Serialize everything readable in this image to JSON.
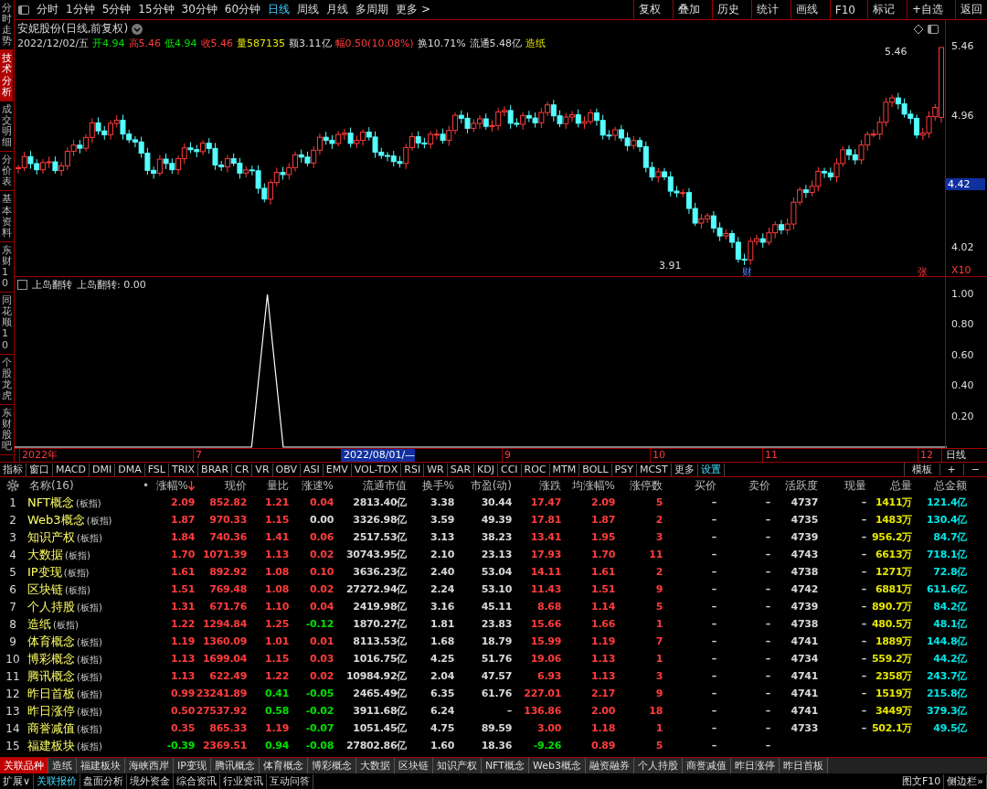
{
  "side_tabs": [
    {
      "label": "分时走势",
      "selected": false
    },
    {
      "label": "技术分析",
      "selected": true
    },
    {
      "label": "成交明细",
      "selected": false
    },
    {
      "label": "分价表",
      "selected": false
    },
    {
      "label": "基本资料",
      "selected": false
    },
    {
      "label": "东财10",
      "selected": false
    },
    {
      "label": "同花顺10",
      "selected": false
    },
    {
      "label": "个股龙虎",
      "selected": false
    },
    {
      "label": "东财股吧",
      "selected": false
    }
  ],
  "periods": [
    {
      "label": "分时",
      "selected": false
    },
    {
      "label": "1分钟",
      "selected": false
    },
    {
      "label": "5分钟",
      "selected": false
    },
    {
      "label": "15分钟",
      "selected": false
    },
    {
      "label": "30分钟",
      "selected": false
    },
    {
      "label": "60分钟",
      "selected": false
    },
    {
      "label": "日线",
      "selected": true
    },
    {
      "label": "周线",
      "selected": false
    },
    {
      "label": "月线",
      "selected": false
    },
    {
      "label": "多周期",
      "selected": false
    },
    {
      "label": "更多 >",
      "selected": false
    }
  ],
  "toolbar_buttons": [
    "复权",
    "叠加",
    "历史",
    "统计",
    "画线",
    "F10",
    "标记",
    "+自选",
    "返回"
  ],
  "stock_title": "安妮股份(日线,前复权)",
  "quote_items": [
    {
      "text": "2022/12/02/五",
      "kind": "flat"
    },
    {
      "text": "开4.94",
      "kind": "down"
    },
    {
      "text": "高5.46",
      "kind": "up"
    },
    {
      "text": "低4.94",
      "kind": "down"
    },
    {
      "text": "收5.46",
      "kind": "up"
    },
    {
      "text": "量587135",
      "kind": "vol"
    },
    {
      "text": "额3.11亿",
      "kind": "flat"
    },
    {
      "text": "幅0.50(10.08%)",
      "kind": "up"
    },
    {
      "text": "换10.71%",
      "kind": "flat"
    },
    {
      "text": "流通5.48亿",
      "kind": "flat"
    },
    {
      "text": "造纸",
      "kind": "vol"
    }
  ],
  "price_axis": [
    {
      "text": "5.46",
      "highlighted": false
    },
    {
      "text": "4.96",
      "highlighted": false
    },
    {
      "text": "4.42",
      "highlighted": true
    },
    {
      "text": "4.02",
      "highlighted": false
    },
    {
      "text": "X10",
      "highlighted": false
    }
  ],
  "price_marks": {
    "high": "5.46",
    "low": "3.91",
    "news_tag": "财",
    "limit_tag": "张"
  },
  "indicator": {
    "reading": ": 0.00",
    "chart_data": {
      "type": "line",
      "title": "上岛翻转",
      "categories": [
        null,
        null,
        null,
        null,
        null,
        null,
        null,
        null,
        null,
        null,
        null,
        null,
        null,
        null,
        null,
        null,
        null,
        null,
        null,
        null,
        null,
        null,
        null,
        null,
        null,
        null,
        null,
        null,
        null,
        null,
        null,
        null,
        null,
        null,
        null,
        null,
        null,
        null,
        null,
        null,
        null,
        null,
        null,
        null,
        null,
        null,
        null,
        null,
        null,
        null,
        null,
        null,
        null,
        null,
        null,
        null,
        null,
        null,
        null,
        null
      ],
      "series": [
        {
          "name": "上岛翻转",
          "color": "#ffffff",
          "values": [
            0,
            0,
            0,
            0,
            0,
            0,
            0,
            0,
            0,
            0,
            0,
            0,
            0,
            0,
            0,
            0,
            1,
            0,
            0,
            0,
            0,
            0,
            0,
            0,
            0,
            0,
            0,
            0,
            0,
            0,
            0,
            0,
            0,
            0,
            0,
            0,
            0,
            0,
            0,
            0,
            0,
            0,
            0,
            0,
            0,
            0,
            0,
            0,
            0,
            0,
            0,
            0,
            0,
            0,
            0,
            0,
            0,
            0,
            0,
            0
          ]
        }
      ],
      "ylim": [
        0,
        1
      ],
      "yticks": [
        {
          "value": 1,
          "label": "1.00"
        },
        {
          "value": 0.8,
          "label": "0.80"
        },
        {
          "value": 0.6,
          "label": "0.60"
        },
        {
          "value": 0.4,
          "label": "0.40"
        },
        {
          "value": 0.2,
          "label": "0.20"
        }
      ]
    }
  },
  "date_axis": [
    {
      "text": "2022年",
      "highlighted": false
    },
    {
      "text": "7",
      "highlighted": false
    },
    {
      "text": "2022/08/01/—",
      "highlighted": true
    },
    {
      "text": "9",
      "highlighted": false
    },
    {
      "text": "10",
      "highlighted": false
    },
    {
      "text": "11",
      "highlighted": false
    },
    {
      "text": "12",
      "highlighted": false
    }
  ],
  "date_axis_period": "日线",
  "indicator_tabs": [
    {
      "label": "指标",
      "kind": "tab"
    },
    {
      "label": "窗口",
      "kind": "tab"
    },
    {
      "label": "MACD",
      "kind": "tab"
    },
    {
      "label": "DMI",
      "kind": "tab"
    },
    {
      "label": "DMA",
      "kind": "tab"
    },
    {
      "label": "FSL",
      "kind": "tab"
    },
    {
      "label": "TRIX",
      "kind": "tab"
    },
    {
      "label": "BRAR",
      "kind": "tab"
    },
    {
      "label": "CR",
      "kind": "tab"
    },
    {
      "label": "VR",
      "kind": "tab"
    },
    {
      "label": "OBV",
      "kind": "tab"
    },
    {
      "label": "ASI",
      "kind": "tab"
    },
    {
      "label": "EMV",
      "kind": "tab"
    },
    {
      "label": "VOL-TDX",
      "kind": "tab"
    },
    {
      "label": "RSI",
      "kind": "tab"
    },
    {
      "label": "WR",
      "kind": "tab"
    },
    {
      "label": "SAR",
      "kind": "tab"
    },
    {
      "label": "KDJ",
      "kind": "tab"
    },
    {
      "label": "CCI",
      "kind": "tab"
    },
    {
      "label": "ROC",
      "kind": "tab"
    },
    {
      "label": "MTM",
      "kind": "tab"
    },
    {
      "label": "BOLL",
      "kind": "tab"
    },
    {
      "label": "PSY",
      "kind": "tab"
    },
    {
      "label": "MCST",
      "kind": "tab"
    },
    {
      "label": "更多",
      "kind": "tab"
    },
    {
      "label": "设置",
      "kind": "action"
    }
  ],
  "indicator_tools": [
    "模板",
    "+",
    "−"
  ],
  "table": {
    "name_header": "名称(16)",
    "dot_header": "•",
    "columns": [
      {
        "label": "涨幅%",
        "sorted": true
      },
      {
        "label": "现价",
        "sorted": false
      },
      {
        "label": "量比",
        "sorted": false
      },
      {
        "label": "涨速%",
        "sorted": false
      },
      {
        "label": "流通市值",
        "sorted": false
      },
      {
        "label": "换手%",
        "sorted": false
      },
      {
        "label": "市盈(动)",
        "sorted": false
      },
      {
        "label": "涨跌",
        "sorted": false
      },
      {
        "label": "均涨幅%",
        "sorted": false
      },
      {
        "label": "涨停数",
        "sorted": false
      },
      {
        "label": "买价",
        "sorted": false
      },
      {
        "label": "卖价",
        "sorted": false
      },
      {
        "label": "活跃度",
        "sorted": false
      },
      {
        "label": "现量",
        "sorted": false
      },
      {
        "label": "总量",
        "sorted": false
      },
      {
        "label": "总金额",
        "sorted": false
      }
    ],
    "rows": [
      {
        "index": "1",
        "name": "NFT概念",
        "tag": "(板指)",
        "cells": [
          {
            "text": "2.09",
            "kind": "up"
          },
          {
            "text": "852.82",
            "kind": "up"
          },
          {
            "text": "1.21",
            "kind": "up"
          },
          {
            "text": "0.04",
            "kind": "up"
          },
          {
            "text": "2813.40亿",
            "kind": "flat"
          },
          {
            "text": "3.38",
            "kind": "flat"
          },
          {
            "text": "30.44",
            "kind": "flat"
          },
          {
            "text": "17.47",
            "kind": "up"
          },
          {
            "text": "2.09",
            "kind": "up"
          },
          {
            "text": "5",
            "kind": "up"
          },
          {
            "text": "–",
            "kind": "flat"
          },
          {
            "text": "–",
            "kind": "flat"
          },
          {
            "text": "4737",
            "kind": "flat"
          },
          {
            "text": "–",
            "kind": "flat"
          },
          {
            "text": "1411万",
            "kind": "vol"
          },
          {
            "text": "121.4亿",
            "kind": "amt"
          }
        ]
      },
      {
        "index": "2",
        "name": "Web3概念",
        "tag": "(板指)",
        "cells": [
          {
            "text": "1.87",
            "kind": "up"
          },
          {
            "text": "970.33",
            "kind": "up"
          },
          {
            "text": "1.15",
            "kind": "up"
          },
          {
            "text": "0.00",
            "kind": "flat"
          },
          {
            "text": "3326.98亿",
            "kind": "flat"
          },
          {
            "text": "3.59",
            "kind": "flat"
          },
          {
            "text": "49.39",
            "kind": "flat"
          },
          {
            "text": "17.81",
            "kind": "up"
          },
          {
            "text": "1.87",
            "kind": "up"
          },
          {
            "text": "2",
            "kind": "up"
          },
          {
            "text": "–",
            "kind": "flat"
          },
          {
            "text": "–",
            "kind": "flat"
          },
          {
            "text": "4735",
            "kind": "flat"
          },
          {
            "text": "–",
            "kind": "flat"
          },
          {
            "text": "1483万",
            "kind": "vol"
          },
          {
            "text": "130.4亿",
            "kind": "amt"
          }
        ]
      },
      {
        "index": "3",
        "name": "知识产权",
        "tag": "(板指)",
        "cells": [
          {
            "text": "1.84",
            "kind": "up"
          },
          {
            "text": "740.36",
            "kind": "up"
          },
          {
            "text": "1.41",
            "kind": "up"
          },
          {
            "text": "0.06",
            "kind": "up"
          },
          {
            "text": "2517.53亿",
            "kind": "flat"
          },
          {
            "text": "3.13",
            "kind": "flat"
          },
          {
            "text": "38.23",
            "kind": "flat"
          },
          {
            "text": "13.41",
            "kind": "up"
          },
          {
            "text": "1.95",
            "kind": "up"
          },
          {
            "text": "3",
            "kind": "up"
          },
          {
            "text": "–",
            "kind": "flat"
          },
          {
            "text": "–",
            "kind": "flat"
          },
          {
            "text": "4739",
            "kind": "flat"
          },
          {
            "text": "–",
            "kind": "flat"
          },
          {
            "text": "956.2万",
            "kind": "vol"
          },
          {
            "text": "84.7亿",
            "kind": "amt"
          }
        ]
      },
      {
        "index": "4",
        "name": "大数据",
        "tag": "(板指)",
        "cells": [
          {
            "text": "1.70",
            "kind": "up"
          },
          {
            "text": "1071.39",
            "kind": "up"
          },
          {
            "text": "1.13",
            "kind": "up"
          },
          {
            "text": "0.02",
            "kind": "up"
          },
          {
            "text": "30743.95亿",
            "kind": "flat"
          },
          {
            "text": "2.10",
            "kind": "flat"
          },
          {
            "text": "23.13",
            "kind": "flat"
          },
          {
            "text": "17.93",
            "kind": "up"
          },
          {
            "text": "1.70",
            "kind": "up"
          },
          {
            "text": "11",
            "kind": "up"
          },
          {
            "text": "–",
            "kind": "flat"
          },
          {
            "text": "–",
            "kind": "flat"
          },
          {
            "text": "4743",
            "kind": "flat"
          },
          {
            "text": "–",
            "kind": "flat"
          },
          {
            "text": "6613万",
            "kind": "vol"
          },
          {
            "text": "718.1亿",
            "kind": "amt"
          }
        ]
      },
      {
        "index": "5",
        "name": "IP变现",
        "tag": "(板指)",
        "cells": [
          {
            "text": "1.61",
            "kind": "up"
          },
          {
            "text": "892.92",
            "kind": "up"
          },
          {
            "text": "1.08",
            "kind": "up"
          },
          {
            "text": "0.10",
            "kind": "up"
          },
          {
            "text": "3636.23亿",
            "kind": "flat"
          },
          {
            "text": "2.40",
            "kind": "flat"
          },
          {
            "text": "53.04",
            "kind": "flat"
          },
          {
            "text": "14.11",
            "kind": "up"
          },
          {
            "text": "1.61",
            "kind": "up"
          },
          {
            "text": "2",
            "kind": "up"
          },
          {
            "text": "–",
            "kind": "flat"
          },
          {
            "text": "–",
            "kind": "flat"
          },
          {
            "text": "4738",
            "kind": "flat"
          },
          {
            "text": "–",
            "kind": "flat"
          },
          {
            "text": "1271万",
            "kind": "vol"
          },
          {
            "text": "72.8亿",
            "kind": "amt"
          }
        ]
      },
      {
        "index": "6",
        "name": "区块链",
        "tag": "(板指)",
        "cells": [
          {
            "text": "1.51",
            "kind": "up"
          },
          {
            "text": "769.48",
            "kind": "up"
          },
          {
            "text": "1.08",
            "kind": "up"
          },
          {
            "text": "0.02",
            "kind": "up"
          },
          {
            "text": "27272.94亿",
            "kind": "flat"
          },
          {
            "text": "2.24",
            "kind": "flat"
          },
          {
            "text": "53.10",
            "kind": "flat"
          },
          {
            "text": "11.43",
            "kind": "up"
          },
          {
            "text": "1.51",
            "kind": "up"
          },
          {
            "text": "9",
            "kind": "up"
          },
          {
            "text": "–",
            "kind": "flat"
          },
          {
            "text": "–",
            "kind": "flat"
          },
          {
            "text": "4742",
            "kind": "flat"
          },
          {
            "text": "–",
            "kind": "flat"
          },
          {
            "text": "6881万",
            "kind": "vol"
          },
          {
            "text": "611.6亿",
            "kind": "amt"
          }
        ]
      },
      {
        "index": "7",
        "name": "个人持股",
        "tag": "(板指)",
        "cells": [
          {
            "text": "1.31",
            "kind": "up"
          },
          {
            "text": "671.76",
            "kind": "up"
          },
          {
            "text": "1.10",
            "kind": "up"
          },
          {
            "text": "0.04",
            "kind": "up"
          },
          {
            "text": "2419.98亿",
            "kind": "flat"
          },
          {
            "text": "3.16",
            "kind": "flat"
          },
          {
            "text": "45.11",
            "kind": "flat"
          },
          {
            "text": "8.68",
            "kind": "up"
          },
          {
            "text": "1.14",
            "kind": "up"
          },
          {
            "text": "5",
            "kind": "up"
          },
          {
            "text": "–",
            "kind": "flat"
          },
          {
            "text": "–",
            "kind": "flat"
          },
          {
            "text": "4739",
            "kind": "flat"
          },
          {
            "text": "–",
            "kind": "flat"
          },
          {
            "text": "890.7万",
            "kind": "vol"
          },
          {
            "text": "84.2亿",
            "kind": "amt"
          }
        ]
      },
      {
        "index": "8",
        "name": "造纸",
        "tag": "(板指)",
        "cells": [
          {
            "text": "1.22",
            "kind": "up"
          },
          {
            "text": "1294.84",
            "kind": "up"
          },
          {
            "text": "1.25",
            "kind": "up"
          },
          {
            "text": "-0.12",
            "kind": "down"
          },
          {
            "text": "1870.27亿",
            "kind": "flat"
          },
          {
            "text": "1.81",
            "kind": "flat"
          },
          {
            "text": "23.83",
            "kind": "flat"
          },
          {
            "text": "15.66",
            "kind": "up"
          },
          {
            "text": "1.66",
            "kind": "up"
          },
          {
            "text": "1",
            "kind": "up"
          },
          {
            "text": "–",
            "kind": "flat"
          },
          {
            "text": "–",
            "kind": "flat"
          },
          {
            "text": "4738",
            "kind": "flat"
          },
          {
            "text": "–",
            "kind": "flat"
          },
          {
            "text": "480.5万",
            "kind": "vol"
          },
          {
            "text": "48.1亿",
            "kind": "amt"
          }
        ]
      },
      {
        "index": "9",
        "name": "体育概念",
        "tag": "(板指)",
        "cells": [
          {
            "text": "1.19",
            "kind": "up"
          },
          {
            "text": "1360.09",
            "kind": "up"
          },
          {
            "text": "1.01",
            "kind": "up"
          },
          {
            "text": "0.01",
            "kind": "up"
          },
          {
            "text": "8113.53亿",
            "kind": "flat"
          },
          {
            "text": "1.68",
            "kind": "flat"
          },
          {
            "text": "18.79",
            "kind": "flat"
          },
          {
            "text": "15.99",
            "kind": "up"
          },
          {
            "text": "1.19",
            "kind": "up"
          },
          {
            "text": "7",
            "kind": "up"
          },
          {
            "text": "–",
            "kind": "flat"
          },
          {
            "text": "–",
            "kind": "flat"
          },
          {
            "text": "4741",
            "kind": "flat"
          },
          {
            "text": "–",
            "kind": "flat"
          },
          {
            "text": "1889万",
            "kind": "vol"
          },
          {
            "text": "144.8亿",
            "kind": "amt"
          }
        ]
      },
      {
        "index": "10",
        "name": "博彩概念",
        "tag": "(板指)",
        "cells": [
          {
            "text": "1.13",
            "kind": "up"
          },
          {
            "text": "1699.04",
            "kind": "up"
          },
          {
            "text": "1.15",
            "kind": "up"
          },
          {
            "text": "0.03",
            "kind": "up"
          },
          {
            "text": "1016.75亿",
            "kind": "flat"
          },
          {
            "text": "4.25",
            "kind": "flat"
          },
          {
            "text": "51.76",
            "kind": "flat"
          },
          {
            "text": "19.06",
            "kind": "up"
          },
          {
            "text": "1.13",
            "kind": "up"
          },
          {
            "text": "1",
            "kind": "up"
          },
          {
            "text": "–",
            "kind": "flat"
          },
          {
            "text": "–",
            "kind": "flat"
          },
          {
            "text": "4734",
            "kind": "flat"
          },
          {
            "text": "–",
            "kind": "flat"
          },
          {
            "text": "559.2万",
            "kind": "vol"
          },
          {
            "text": "44.2亿",
            "kind": "amt"
          }
        ]
      },
      {
        "index": "11",
        "name": "腾讯概念",
        "tag": "(板指)",
        "cells": [
          {
            "text": "1.13",
            "kind": "up"
          },
          {
            "text": "622.49",
            "kind": "up"
          },
          {
            "text": "1.22",
            "kind": "up"
          },
          {
            "text": "0.02",
            "kind": "up"
          },
          {
            "text": "10984.92亿",
            "kind": "flat"
          },
          {
            "text": "2.04",
            "kind": "flat"
          },
          {
            "text": "47.57",
            "kind": "flat"
          },
          {
            "text": "6.93",
            "kind": "up"
          },
          {
            "text": "1.13",
            "kind": "up"
          },
          {
            "text": "3",
            "kind": "up"
          },
          {
            "text": "–",
            "kind": "flat"
          },
          {
            "text": "–",
            "kind": "flat"
          },
          {
            "text": "4741",
            "kind": "flat"
          },
          {
            "text": "–",
            "kind": "flat"
          },
          {
            "text": "2358万",
            "kind": "vol"
          },
          {
            "text": "243.7亿",
            "kind": "amt"
          }
        ]
      },
      {
        "index": "12",
        "name": "昨日首板",
        "tag": "(板指)",
        "cells": [
          {
            "text": "0.99",
            "kind": "up"
          },
          {
            "text": "23241.89",
            "kind": "up"
          },
          {
            "text": "0.41",
            "kind": "down"
          },
          {
            "text": "-0.05",
            "kind": "down"
          },
          {
            "text": "2465.49亿",
            "kind": "flat"
          },
          {
            "text": "6.35",
            "kind": "flat"
          },
          {
            "text": "61.76",
            "kind": "flat"
          },
          {
            "text": "227.01",
            "kind": "up"
          },
          {
            "text": "2.17",
            "kind": "up"
          },
          {
            "text": "9",
            "kind": "up"
          },
          {
            "text": "–",
            "kind": "flat"
          },
          {
            "text": "–",
            "kind": "flat"
          },
          {
            "text": "4741",
            "kind": "flat"
          },
          {
            "text": "–",
            "kind": "flat"
          },
          {
            "text": "1519万",
            "kind": "vol"
          },
          {
            "text": "215.8亿",
            "kind": "amt"
          }
        ]
      },
      {
        "index": "13",
        "name": "昨日涨停",
        "tag": "(板指)",
        "cells": [
          {
            "text": "0.50",
            "kind": "up"
          },
          {
            "text": "27537.92",
            "kind": "up"
          },
          {
            "text": "0.58",
            "kind": "down"
          },
          {
            "text": "-0.02",
            "kind": "down"
          },
          {
            "text": "3911.68亿",
            "kind": "flat"
          },
          {
            "text": "6.24",
            "kind": "flat"
          },
          {
            "text": "–",
            "kind": "flat"
          },
          {
            "text": "136.86",
            "kind": "up"
          },
          {
            "text": "2.00",
            "kind": "up"
          },
          {
            "text": "18",
            "kind": "up"
          },
          {
            "text": "–",
            "kind": "flat"
          },
          {
            "text": "–",
            "kind": "flat"
          },
          {
            "text": "4741",
            "kind": "flat"
          },
          {
            "text": "–",
            "kind": "flat"
          },
          {
            "text": "3449万",
            "kind": "vol"
          },
          {
            "text": "379.3亿",
            "kind": "amt"
          }
        ]
      },
      {
        "index": "14",
        "name": "商誉减值",
        "tag": "(板指)",
        "cells": [
          {
            "text": "0.35",
            "kind": "up"
          },
          {
            "text": "865.33",
            "kind": "up"
          },
          {
            "text": "1.19",
            "kind": "up"
          },
          {
            "text": "-0.07",
            "kind": "down"
          },
          {
            "text": "1051.45亿",
            "kind": "flat"
          },
          {
            "text": "4.75",
            "kind": "flat"
          },
          {
            "text": "89.59",
            "kind": "flat"
          },
          {
            "text": "3.00",
            "kind": "up"
          },
          {
            "text": "1.18",
            "kind": "up"
          },
          {
            "text": "1",
            "kind": "up"
          },
          {
            "text": "–",
            "kind": "flat"
          },
          {
            "text": "–",
            "kind": "flat"
          },
          {
            "text": "4733",
            "kind": "flat"
          },
          {
            "text": "–",
            "kind": "flat"
          },
          {
            "text": "502.1万",
            "kind": "vol"
          },
          {
            "text": "49.5亿",
            "kind": "amt"
          }
        ]
      },
      {
        "index": "15",
        "name": "福建板块",
        "tag": "(板指)",
        "cells": [
          {
            "text": "-0.39",
            "kind": "down"
          },
          {
            "text": "2369.51",
            "kind": "up"
          },
          {
            "text": "0.94",
            "kind": "down"
          },
          {
            "text": "-0.08",
            "kind": "down"
          },
          {
            "text": "27802.86亿",
            "kind": "flat"
          },
          {
            "text": "1.60",
            "kind": "flat"
          },
          {
            "text": "18.36",
            "kind": "flat"
          },
          {
            "text": "-9.26",
            "kind": "down"
          },
          {
            "text": "0.89",
            "kind": "up"
          },
          {
            "text": "5",
            "kind": "up"
          },
          {
            "text": "–",
            "kind": "flat"
          },
          {
            "text": "–",
            "kind": "flat"
          },
          null,
          null,
          null,
          null
        ]
      }
    ]
  },
  "related_tabs": [
    {
      "label": "关联品种",
      "selected": true
    },
    {
      "label": "造纸",
      "selected": false
    },
    {
      "label": "福建板块",
      "selected": false
    },
    {
      "label": "海峡西岸",
      "selected": false
    },
    {
      "label": "IP变现",
      "selected": false
    },
    {
      "label": "腾讯概念",
      "selected": false
    },
    {
      "label": "体育概念",
      "selected": false
    },
    {
      "label": "博彩概念",
      "selected": false
    },
    {
      "label": "大数据",
      "selected": false
    },
    {
      "label": "区块链",
      "selected": false
    },
    {
      "label": "知识产权",
      "selected": false
    },
    {
      "label": "NFT概念",
      "selected": false
    },
    {
      "label": "Web3概念",
      "selected": false
    },
    {
      "label": "融资融券",
      "selected": false
    },
    {
      "label": "个人持股",
      "selected": false
    },
    {
      "label": "商誉减值",
      "selected": false
    },
    {
      "label": "昨日涨停",
      "selected": false
    },
    {
      "label": "昨日首板",
      "selected": false
    }
  ],
  "bottom_tabs": [
    {
      "label": "扩展∨",
      "selected": false
    },
    {
      "label": "关联报价",
      "selected": true
    },
    {
      "label": "盘面分析",
      "selected": false
    },
    {
      "label": "境外资金",
      "selected": false
    },
    {
      "label": "综合资讯",
      "selected": false
    },
    {
      "label": "行业资讯",
      "selected": false
    },
    {
      "label": "互动问答",
      "selected": false
    }
  ],
  "bottom_right": [
    "图文F10",
    "侧边栏»"
  ]
}
